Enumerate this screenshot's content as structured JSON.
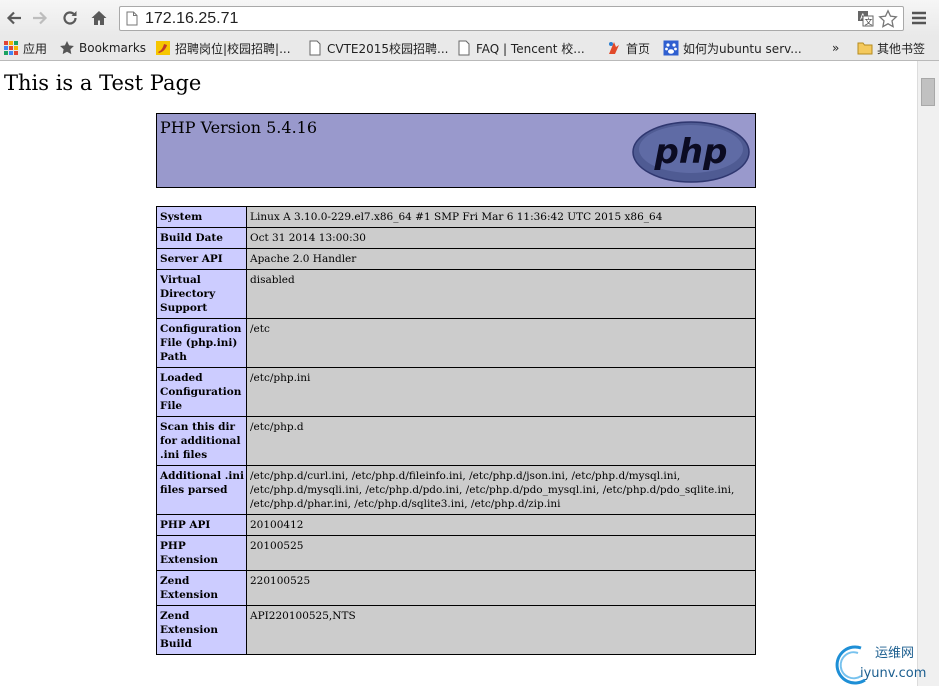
{
  "browser": {
    "url": "172.16.25.71",
    "bookmarks": [
      {
        "label": "应用",
        "icon": "apps-grid-icon"
      },
      {
        "label": "Bookmarks",
        "icon": "star-icon"
      },
      {
        "label": "招聘岗位|校园招聘|...",
        "icon": "site-favicon"
      },
      {
        "label": "CVTE2015校园招聘...",
        "icon": "page-icon"
      },
      {
        "label": "FAQ | Tencent 校...",
        "icon": "page-icon"
      },
      {
        "label": "首页",
        "icon": "site-favicon"
      },
      {
        "label": "如何为ubuntu serv...",
        "icon": "baidu-paw-icon"
      },
      {
        "label": "»",
        "icon": "chevron-more-icon"
      },
      {
        "label": "其他书签",
        "icon": "folder-icon"
      }
    ]
  },
  "page": {
    "heading": "This is a Test Page",
    "php_version": "PHP Version 5.4.16",
    "rows": [
      {
        "key": "System",
        "value": "Linux A 3.10.0-229.el7.x86_64 #1 SMP Fri Mar 6 11:36:42 UTC 2015 x86_64"
      },
      {
        "key": "Build Date",
        "value": "Oct 31 2014 13:00:30"
      },
      {
        "key": "Server API",
        "value": "Apache 2.0 Handler"
      },
      {
        "key": "Virtual Directory Support",
        "value": "disabled"
      },
      {
        "key": "Configuration File (php.ini) Path",
        "value": "/etc"
      },
      {
        "key": "Loaded Configuration File",
        "value": "/etc/php.ini"
      },
      {
        "key": "Scan this dir for additional .ini files",
        "value": "/etc/php.d"
      },
      {
        "key": "Additional .ini files parsed",
        "value": "/etc/php.d/curl.ini, /etc/php.d/fileinfo.ini, /etc/php.d/json.ini, /etc/php.d/mysql.ini, /etc/php.d/mysqli.ini, /etc/php.d/pdo.ini, /etc/php.d/pdo_mysql.ini, /etc/php.d/pdo_sqlite.ini, /etc/php.d/phar.ini, /etc/php.d/sqlite3.ini, /etc/php.d/zip.ini"
      },
      {
        "key": "PHP API",
        "value": "20100412"
      },
      {
        "key": "PHP Extension",
        "value": "20100525"
      },
      {
        "key": "Zend Extension",
        "value": "220100525"
      },
      {
        "key": "Zend Extension Build",
        "value": "API220100525,NTS"
      }
    ]
  },
  "watermark": {
    "name": "运维网",
    "domain": "iyunv.com"
  }
}
